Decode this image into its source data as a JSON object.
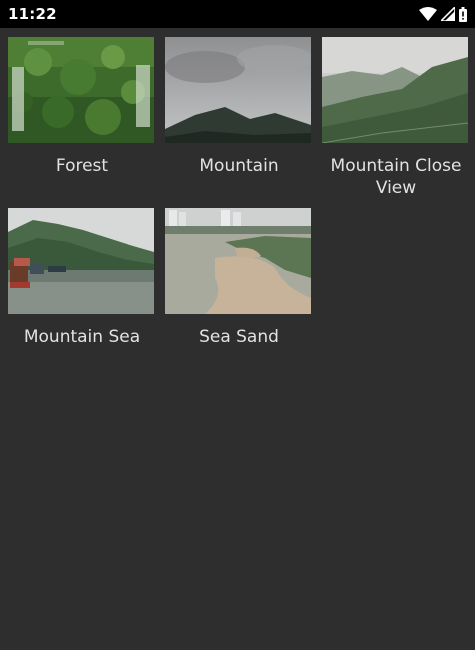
{
  "status_bar": {
    "time": "11:22",
    "icons": [
      "wifi-icon",
      "cellular-signal-icon",
      "battery-icon"
    ]
  },
  "gallery": {
    "items": [
      {
        "title": "Forest"
      },
      {
        "title": "Mountain"
      },
      {
        "title": "Mountain Close View"
      },
      {
        "title": "Mountain Sea"
      },
      {
        "title": "Sea Sand"
      }
    ]
  },
  "colors": {
    "background": "#2e2e2e",
    "status_bar": "#000000",
    "caption_text": "#e2e2e2"
  }
}
